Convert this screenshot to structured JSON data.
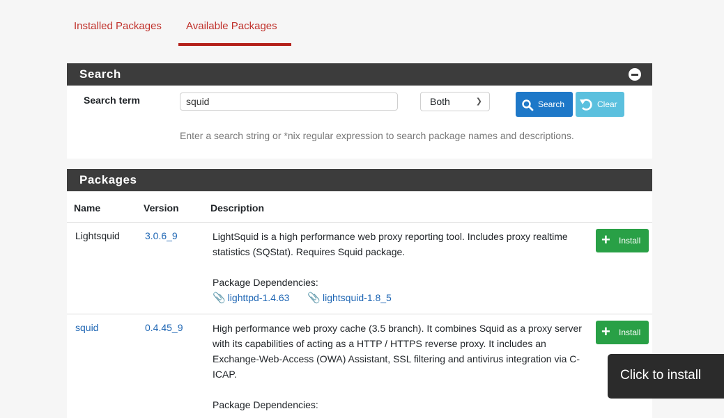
{
  "tabs": [
    {
      "label": "Installed Packages"
    },
    {
      "label": "Available Packages"
    }
  ],
  "search_panel": {
    "title": "Search",
    "term_label": "Search term",
    "term_value": "squid",
    "scope_selected": "Both",
    "search_button": "Search",
    "clear_button": "Clear",
    "help_text": "Enter a search string or *nix regular expression to search package names and descriptions."
  },
  "packages_panel": {
    "title": "Packages",
    "columns": [
      "Name",
      "Version",
      "Description"
    ],
    "rows": [
      {
        "name": "Lightsquid",
        "version": "3.0.6_9",
        "description": "LightSquid is a high performance web proxy reporting tool. Includes proxy realtime statistics (SQStat). Requires Squid package.",
        "deps_label": "Package Dependencies:",
        "deps": [
          "lighttpd-1.4.63",
          "lightsquid-1.8_5"
        ],
        "install_label": "Install"
      },
      {
        "name": "squid",
        "version": "0.4.45_9",
        "description": "High performance web proxy cache (3.5 branch). It combines Squid as a proxy server with its capabilities of acting as a HTTP / HTTPS reverse proxy. It includes an Exchange-Web-Access (OWA) Assistant, SSL filtering and antivirus integration via C-ICAP.",
        "deps_label": "Package Dependencies:",
        "install_label": "Install"
      }
    ]
  },
  "tooltip": "Click to install",
  "colors": {
    "accent_red": "#b4201a",
    "panel_header": "#3c3c3c",
    "search_blue": "#1e78c8",
    "clear_cyan": "#5bc0de",
    "install_green": "#29a046",
    "link_blue": "#1e66b4"
  },
  "icons": [
    "minus-circle-icon",
    "search-icon",
    "undo-icon",
    "plus-icon",
    "paperclip-icon"
  ]
}
